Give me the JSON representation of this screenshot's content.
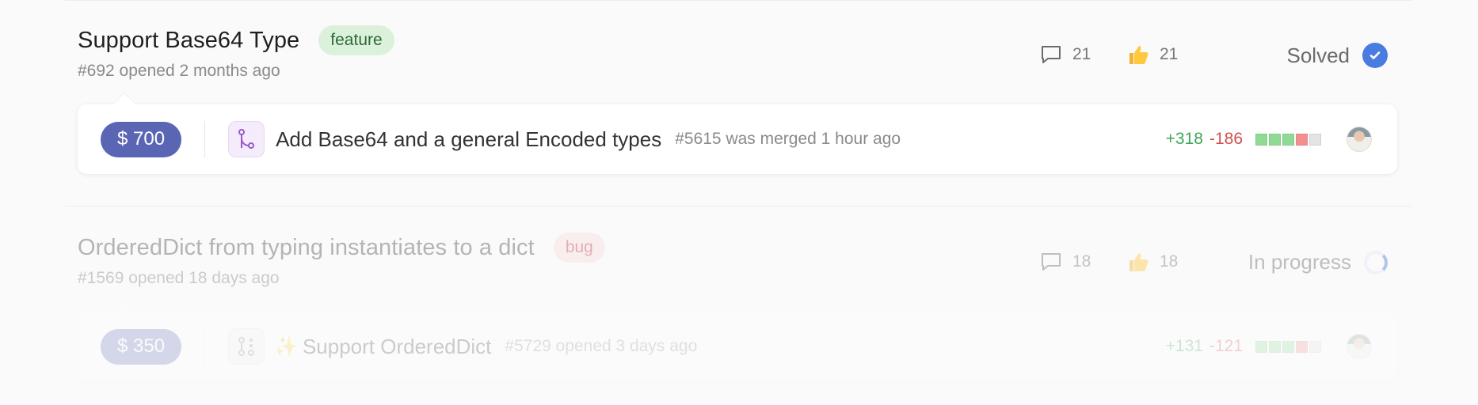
{
  "issues": [
    {
      "title": "Support Base64 Type",
      "label": "feature",
      "meta": "#692 opened 2 months ago",
      "comments": "21",
      "thumbs": "21",
      "status": "Solved",
      "pr": {
        "bounty": "$ 700",
        "title": "Add Base64 and a general Encoded types",
        "meta": "#5615 was merged 1 hour ago",
        "additions": "+318",
        "deletions": "-186"
      }
    },
    {
      "title": "OrderedDict from typing instantiates to a dict",
      "label": "bug",
      "meta": "#1569 opened 18 days ago",
      "comments": "18",
      "thumbs": "18",
      "status": "In progress",
      "pr": {
        "bounty": "$ 350",
        "sparkle": "✨",
        "title": "Support OrderedDict",
        "meta": "#5729 opened 3 days ago",
        "additions": "+131",
        "deletions": "-121"
      }
    }
  ],
  "colors": {
    "accent_blue": "#4a7be0",
    "bounty_bg": "#5a66b4",
    "feature_label": "#dcf1dc",
    "bug_label": "#fbdcdc",
    "additions": "#3ea555",
    "deletions": "#d24e4e"
  },
  "icons": {
    "comments": "speech-bubble-icon",
    "thumbs": "thumbs-up-icon",
    "solved": "check-circle-icon",
    "in_progress": "progress-spinner-icon",
    "merged_pr": "git-merge-icon",
    "open_pr": "git-pull-request-icon"
  }
}
